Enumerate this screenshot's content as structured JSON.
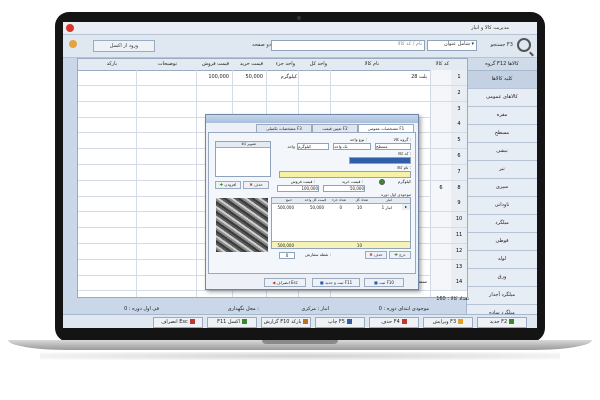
{
  "window": {
    "title": "مدیریت کالا و انبار"
  },
  "toolbar": {
    "search_label": "جستجو F3",
    "search_mode": "شامل عنوان",
    "search_value": "",
    "search_placeholder": "نام / کد کالا",
    "filter_label": "دو صفحه",
    "export_button": "ورود از اکسل",
    "menu_icon": "gear-icon"
  },
  "sidebar": {
    "header": "گروه F12 کالاها",
    "items": [
      "کلیه کالاها",
      "کالاهای عمومی",
      "مقره",
      "مسطح",
      "نبشی",
      "تیر",
      "سپری",
      "ناودانی",
      "میلگرد",
      "قوطی",
      "لوله",
      "ورق",
      "میلگرد آجدار",
      "میلگرد ساده",
      "تاورپی"
    ],
    "selected_index": 0
  },
  "grid": {
    "columns": [
      "کد کالا",
      "نام کالا",
      "واحد کل",
      "واحد جزء",
      "قیمت خرید",
      "قیمت فروش",
      "توضیحات",
      "بارکد"
    ],
    "rows": [
      {
        "num": "1",
        "sel": "",
        "code": "",
        "name": "پلت 28",
        "unit": "",
        "subunit": "کیلوگرم",
        "buy": "50,000",
        "sell": "100,000"
      },
      {
        "num": "2",
        "sel": "",
        "code": "",
        "name": "",
        "unit": "",
        "subunit": "",
        "buy": "",
        "sell": ""
      },
      {
        "num": "3",
        "sel": "",
        "code": "",
        "name": "",
        "unit": "",
        "subunit": "",
        "buy": "",
        "sell": ""
      },
      {
        "num": "4",
        "sel": "",
        "code": "",
        "name": "",
        "unit": "",
        "subunit": "",
        "buy": "",
        "sell": ""
      },
      {
        "num": "5",
        "sel": "",
        "code": "",
        "name": "",
        "unit": "",
        "subunit": "",
        "buy": "",
        "sell": ""
      },
      {
        "num": "6",
        "sel": "",
        "code": "",
        "name": "",
        "unit": "",
        "subunit": "",
        "buy": "",
        "sell": ""
      },
      {
        "num": "7",
        "sel": "",
        "code": "",
        "name": "",
        "unit": "",
        "subunit": "",
        "buy": "",
        "sell": ""
      },
      {
        "num": "8",
        "sel": "6",
        "code": "",
        "name": "",
        "unit": "",
        "subunit": "",
        "buy": "",
        "sell": ""
      },
      {
        "num": "9",
        "sel": "",
        "code": "",
        "name": "",
        "unit": "",
        "subunit": "",
        "buy": "",
        "sell": ""
      },
      {
        "num": "10",
        "sel": "",
        "code": "",
        "name": "",
        "unit": "",
        "subunit": "",
        "buy": "",
        "sell": ""
      },
      {
        "num": "11",
        "sel": "",
        "code": "",
        "name": "",
        "unit": "",
        "subunit": "",
        "buy": "",
        "sell": ""
      },
      {
        "num": "12",
        "sel": "",
        "code": "",
        "name": "",
        "unit": "",
        "subunit": "",
        "buy": "",
        "sell": ""
      },
      {
        "num": "13",
        "sel": "",
        "code": "",
        "name": "",
        "unit": "",
        "subunit": "",
        "buy": "",
        "sell": ""
      },
      {
        "num": "14",
        "sel": "",
        "code": "",
        "name": "سمنه 2-6 مبل",
        "unit": "",
        "subunit": "کیلوگرم",
        "buy": "50,000",
        "sell": "100,000"
      }
    ]
  },
  "status": {
    "count": "تعداد کالا : 160",
    "group": "موجودی ابتدای دوره : 0",
    "warehouse": "انبار : مرکزی",
    "place": "محل نگهداری :",
    "stock": "فی اول دوره : 0"
  },
  "bottom_buttons": [
    {
      "label": "جدید F2",
      "icon": "plus-icon"
    },
    {
      "label": "ویرایش F3",
      "icon": "edit-icon"
    },
    {
      "label": "حذف F4",
      "icon": "delete-icon"
    },
    {
      "label": "چاپ F5",
      "icon": "print-icon"
    },
    {
      "label": "گزارش F10 بارکد",
      "icon": "barcode-icon"
    },
    {
      "label": "F11 اکسل",
      "icon": "excel-icon"
    },
    {
      "label": "انصراف Esc",
      "icon": "exit-icon"
    }
  ],
  "dialog": {
    "tabs": [
      "مشخصات عمومی F1",
      "تعیین قیمت F2",
      "مشخصات تکمیلی F3"
    ],
    "group_label": "گروه کالا :",
    "group_value": "مسطح",
    "type_label": "نوع واحد :",
    "type_value": "تک واحد",
    "unit_label": "واحد",
    "unit_value": "کیلوگرم",
    "code_label": "کد کالا :",
    "name_label": "نام کالا :",
    "buy_label": "قیمت خرید :",
    "buy_value": "50,000",
    "sell_label": "قیمت فروش :",
    "sell_value": "100,000",
    "radio_label": "کیلوگرم",
    "image_label": "تصویر کالا",
    "add_image": "افزودن",
    "remove_image": "حذف",
    "table_title": "موجودی اول دوره",
    "table_cols": [
      "انبار",
      "تعداد کل",
      "تعداد جزء",
      "قیمت کل واحد",
      "جمع"
    ],
    "table_row": {
      "store": "انبار 1",
      "total": "10",
      "sub": "0",
      "price": "50,000",
      "sum": "500,000"
    },
    "table_sum": "500,000",
    "table_sum_count": "10",
    "add_row": "درج",
    "del_row": "حذف",
    "reserve_label": "نقطه سفارش :",
    "reserve_value": "0",
    "save_btn": "ثبت F10",
    "save_new_btn": "ثبت و جدید F11",
    "cancel_btn": "انصراف Esc"
  }
}
